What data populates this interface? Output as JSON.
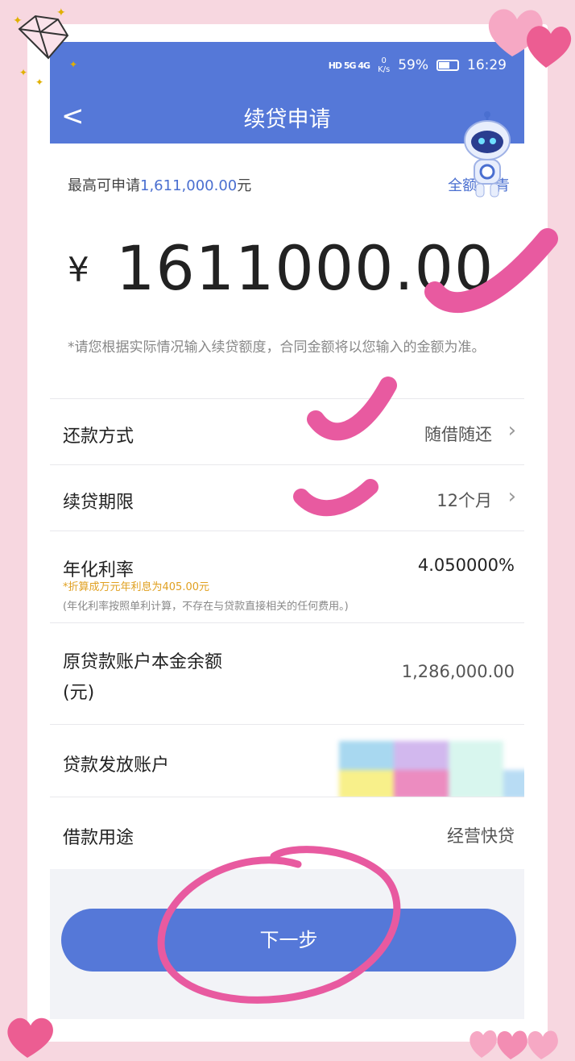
{
  "status_bar": {
    "network": "HD 5G 4G",
    "speed_value": "0",
    "speed_unit": "K/s",
    "battery": "59%",
    "time": "16:29"
  },
  "header": {
    "back_label": "<",
    "title": "续贷申请"
  },
  "amount_card": {
    "max_prefix": "最高可申请",
    "max_amount": "1,611,000.00",
    "max_suffix": "元",
    "full_amount_button": "全额",
    "full_amount_button_tail": "青",
    "currency": "¥",
    "amount": "1611000.00",
    "hint": "*请您根据实际情况输入续贷额度，合同金额将以您输入的金额为准。"
  },
  "rows": {
    "repayment": {
      "label": "还款方式",
      "value": "随借随还"
    },
    "term": {
      "label": "续贷期限",
      "value": "12个月"
    },
    "rate": {
      "label": "年化利率",
      "value": "4.050000%",
      "note1": "*折算成万元年利息为405.00元",
      "note2": "(年化利率按照单利计算，不存在与贷款直接相关的任何费用。)"
    },
    "principal": {
      "label_line1": "原贷款账户本金余额",
      "label_line2": "(元)",
      "value": "1,286,000.00"
    },
    "account": {
      "label": "贷款发放账户"
    },
    "purpose": {
      "label": "借款用途",
      "value": "经营快贷"
    }
  },
  "next_button": "下一步",
  "colors": {
    "brand_blue": "#5578d8",
    "accent_link": "#4a6fd0",
    "note_orange": "#e0a020",
    "scribble_pink": "#e85aa0",
    "background_pink": "#f7d7e0"
  }
}
